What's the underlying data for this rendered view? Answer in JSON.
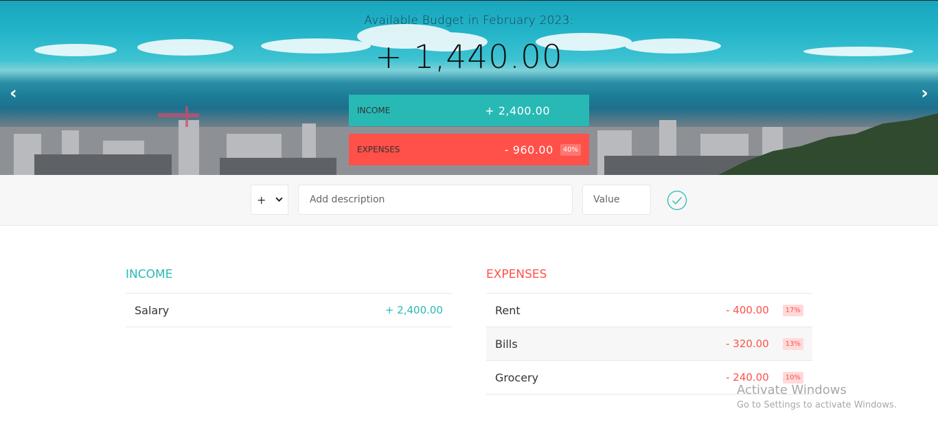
{
  "header": {
    "title": "Available Budget in February 2023:",
    "budget": "+ 1,440.00",
    "income_label": "Income",
    "income_value": "+ 2,400.00",
    "expenses_label": "Expenses",
    "expenses_value": "- 960.00",
    "expenses_percentage": "40%",
    "prev_arrow": "‹",
    "next_arrow": "›"
  },
  "add_form": {
    "type_selected": "+",
    "description_placeholder": "Add description",
    "value_placeholder": "Value"
  },
  "income": {
    "title": "Income",
    "items": [
      {
        "description": "Salary",
        "value": "+ 2,400.00"
      }
    ]
  },
  "expenses": {
    "title": "Expenses",
    "items": [
      {
        "description": "Rent",
        "value": "- 400.00",
        "percentage": "17%"
      },
      {
        "description": "Bills",
        "value": "- 320.00",
        "percentage": "13%"
      },
      {
        "description": "Grocery",
        "value": "- 240.00",
        "percentage": "10%"
      }
    ]
  },
  "watermark": {
    "line1": "Activate Windows",
    "line2": "Go to Settings to activate Windows."
  },
  "colors": {
    "income_accent": "#28b9b5",
    "expenses_accent": "#ff5049"
  },
  "icons": {
    "add_button": "check-circle-icon",
    "type_select": "chevron-down-icon"
  }
}
